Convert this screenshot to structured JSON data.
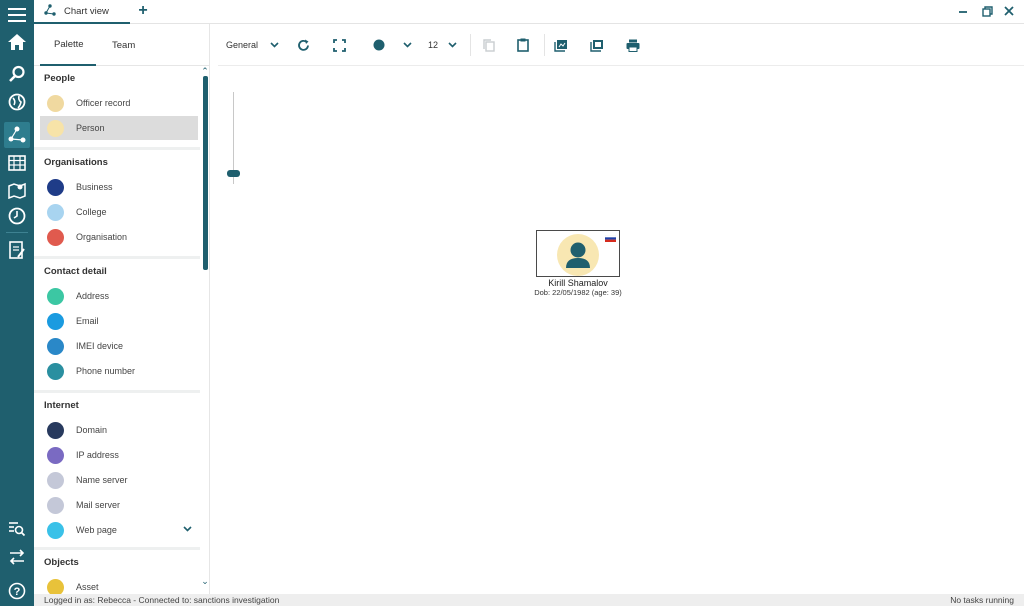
{
  "window": {
    "tab_title": "Chart view"
  },
  "rail": {
    "items": [
      {
        "icon": "menu-icon"
      },
      {
        "icon": "home-icon"
      },
      {
        "icon": "search-icon"
      },
      {
        "icon": "globe-icon"
      },
      {
        "icon": "chart-network-icon",
        "active": true
      },
      {
        "icon": "table-icon"
      },
      {
        "icon": "map-icon"
      },
      {
        "icon": "clock-icon"
      },
      {
        "icon": "report-icon"
      },
      {
        "icon": "search-list-icon"
      },
      {
        "icon": "transfer-icon"
      },
      {
        "icon": "help-icon"
      }
    ],
    "accent": "#1f5f6e"
  },
  "palette": {
    "tabs": [
      "Palette",
      "Team"
    ],
    "groups": [
      {
        "title": "People",
        "items": [
          {
            "label": "Officer record",
            "icon": "officer-record-icon",
            "color": "#f0d9a0"
          },
          {
            "label": "Person",
            "icon": "person-icon",
            "color": "#f7e3a8",
            "selected": true
          }
        ]
      },
      {
        "title": "Organisations",
        "items": [
          {
            "label": "Business",
            "icon": "business-icon",
            "color": "#1f3c88"
          },
          {
            "label": "College",
            "icon": "college-icon",
            "color": "#a8d4f0"
          },
          {
            "label": "Organisation",
            "icon": "organisation-icon",
            "color": "#e05a4e"
          }
        ]
      },
      {
        "title": "Contact detail",
        "items": [
          {
            "label": "Address",
            "icon": "address-icon",
            "color": "#3cc7a3"
          },
          {
            "label": "Email",
            "icon": "email-icon",
            "color": "#1a9be0"
          },
          {
            "label": "IMEI device",
            "icon": "imei-device-icon",
            "color": "#2a88c8"
          },
          {
            "label": "Phone number",
            "icon": "phone-number-icon",
            "color": "#2a8fa0"
          }
        ]
      },
      {
        "title": "Internet",
        "items": [
          {
            "label": "Domain",
            "icon": "domain-icon",
            "color": "#283a5e"
          },
          {
            "label": "IP address",
            "icon": "ip-address-icon",
            "color": "#7a6ac2"
          },
          {
            "label": "Name server",
            "icon": "name-server-icon",
            "color": "#c4c8d8"
          },
          {
            "label": "Mail server",
            "icon": "mail-server-icon",
            "color": "#c4c8d8"
          },
          {
            "label": "Web page",
            "icon": "web-page-icon",
            "color": "#3ac1e8"
          }
        ]
      },
      {
        "title": "Objects",
        "items": [
          {
            "label": "Asset",
            "icon": "asset-icon",
            "color": "#e8c23a"
          }
        ]
      }
    ]
  },
  "toolbar": {
    "layout_label": "General",
    "font_size": "12"
  },
  "canvas": {
    "entity": {
      "name": "Kirill Shamalov",
      "dob": "Dob: 22/05/1982 (age: 39)"
    }
  },
  "status": {
    "left": "Logged in as: Rebecca - Connected to: sanctions investigation",
    "right": "No tasks running"
  }
}
